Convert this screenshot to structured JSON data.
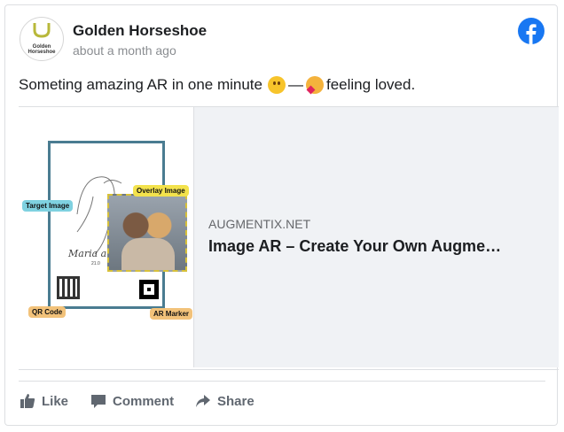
{
  "post": {
    "page_name": "Golden Horseshoe",
    "timestamp": "about a month ago",
    "avatar_text": "Golden\nHorseshoe",
    "text_before": "Someting amazing AR in one minute",
    "text_dash": "—",
    "text_feeling": "feeling loved.",
    "emojis": [
      "slightly-smiling-face",
      "smiling-face-with-hearts"
    ]
  },
  "link_preview": {
    "domain": "AUGMENTIX.NET",
    "title": "Image AR – Create Your Own Augme…",
    "image": {
      "script_name": "Maria an",
      "date": "21.0",
      "tags": {
        "target": "Target Image",
        "overlay": "Overlay Image",
        "qr": "QR Code",
        "ar": "AR Marker"
      }
    }
  },
  "actions": {
    "like": "Like",
    "comment": "Comment",
    "share": "Share"
  },
  "colors": {
    "facebook_blue": "#1877f2",
    "action_gray": "#606770",
    "link_bg": "#f0f2f5"
  }
}
